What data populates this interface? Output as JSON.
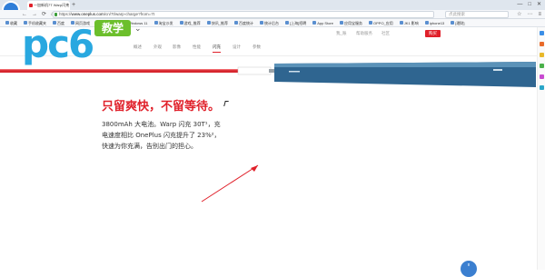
{
  "browser": {
    "tab_title": "一加新机7T Warp闪充",
    "new_tab_symbol": "+",
    "window_controls": [
      "—",
      "□",
      "✕"
    ],
    "nav_symbols": [
      "←",
      "→",
      "⟳",
      "⌂"
    ],
    "url_prefix": "https://",
    "url_domain": "www.oneplus.com",
    "url_path": "/cn/7t/warp-charge?from=7t",
    "search_placeholder": "点此搜索",
    "right_tools": [
      "☆",
      "⋯",
      "≡"
    ]
  },
  "bookmarks": [
    "收藏",
    "手机收藏夹",
    "百度",
    "网页游戏",
    "MSN 国际",
    "Windows 11",
    "淘宝沙发",
    "游戏_推荐",
    "快讯_推荐",
    "百度统计",
    "统计后台",
    "[上海]招聘",
    "App Store",
    "应用宝服务",
    "OPPO_应用",
    "JK1 影响",
    "iphone13",
    "[理财]"
  ],
  "site": {
    "nav_links": [
      "我_账",
      "帮助服务",
      "社区"
    ],
    "buy_label": "购买"
  },
  "subnav": {
    "items": [
      "概述",
      "外观",
      "影像",
      "性能",
      "闪充",
      "设计",
      "参数"
    ],
    "active_index": 4
  },
  "watermark": {
    "brand_text": "pc6",
    "badge_text": "教学",
    "chevron": "⌄"
  },
  "main": {
    "headline": "只留爽快，不留等待。",
    "paragraph_line1": "3800mAh 大电池。Warp 闪充 30T¹，充",
    "paragraph_line2": "电速度相比 OnePlus 闪充提升了 23%²，",
    "paragraph_line3": "快速为你充满，告别出门的担心。",
    "float_button": "⬆"
  },
  "colors": {
    "accent": "#e0202a",
    "watermark_blue": "#29a8e0",
    "watermark_green": "#6cbf2c"
  }
}
